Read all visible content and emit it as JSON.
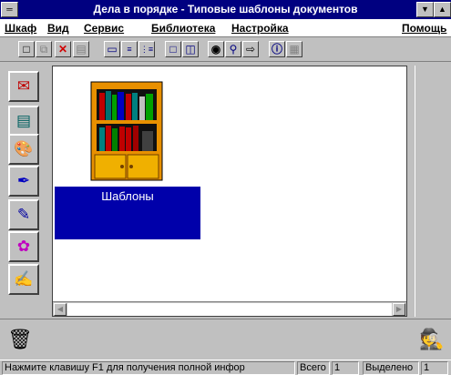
{
  "window": {
    "title": "Дела в порядке - Типовые шаблоны документов",
    "sys_menu_glyph": "═",
    "minimize_glyph": "▼",
    "maximize_glyph": "▲"
  },
  "menu": {
    "items": [
      "Шкаф",
      "Вид",
      "Сервис",
      "Библиотека",
      "Настройка"
    ],
    "help": "Помощь"
  },
  "toolbar": {
    "icons": [
      "new-document-icon",
      "copy-icon",
      "delete-icon",
      "print-icon",
      "properties-icon",
      "small-icons-view-icon",
      "list-view-icon",
      "large-icons-view-icon",
      "split-view-icon",
      "binoculars-icon",
      "search-icon",
      "export-icon",
      "info-icon",
      "grid-icon"
    ]
  },
  "left_tools": {
    "icons": [
      "mail-icon",
      "notebook-icon",
      "palette-icon",
      "pen-icon",
      "image-edit-icon",
      "certificate-icon",
      "notes-icon"
    ]
  },
  "main": {
    "folder_label": "Шаблоны"
  },
  "status": {
    "hint": "Нажмите клавишу F1 для получения полной инфор",
    "total_label": "Всего",
    "total_value": "1",
    "selected_label": "Выделено",
    "selected_value": "1"
  },
  "colors": {
    "titlebar": "#000080",
    "selection": "#0000aa",
    "face": "#c0c0c0"
  }
}
